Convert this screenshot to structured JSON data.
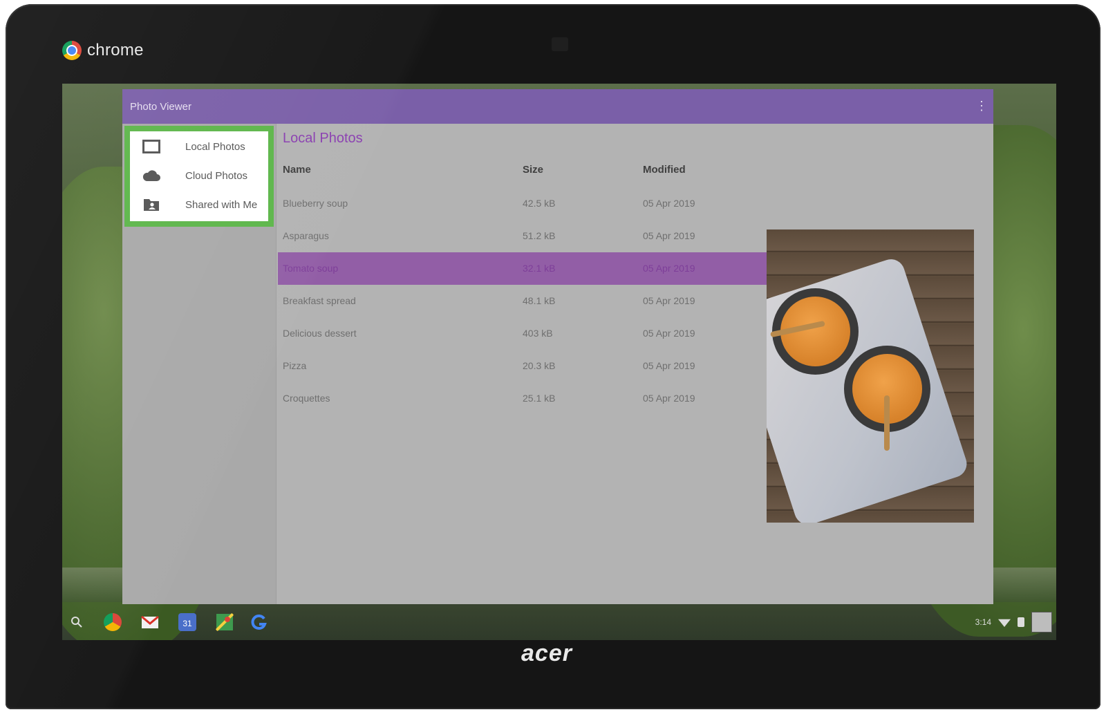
{
  "device": {
    "brand_label": "chrome",
    "logo_text": "acer"
  },
  "app": {
    "title": "Photo Viewer",
    "menu_icon": "more-vertical-icon"
  },
  "sidebar": {
    "items": [
      {
        "label": "Local Photos",
        "icon": "photo-frame-icon"
      },
      {
        "label": "Cloud Photos",
        "icon": "cloud-icon"
      },
      {
        "label": "Shared with Me",
        "icon": "shared-folder-icon"
      }
    ]
  },
  "main": {
    "section_title": "Local Photos",
    "columns": {
      "name": "Name",
      "size": "Size",
      "modified": "Modified"
    },
    "rows": [
      {
        "name": "Blueberry soup",
        "size": "42.5 kB",
        "modified": "05 Apr 2019"
      },
      {
        "name": "Asparagus",
        "size": "51.2 kB",
        "modified": "05 Apr 2019"
      },
      {
        "name": "Tomato soup",
        "size": "32.1 kB",
        "modified": "05 Apr 2019",
        "selected": true
      },
      {
        "name": "Breakfast spread",
        "size": "48.1 kB",
        "modified": "05 Apr 2019"
      },
      {
        "name": "Delicious dessert",
        "size": "403 kB",
        "modified": "05 Apr 2019"
      },
      {
        "name": "Pizza",
        "size": "20.3 kB",
        "modified": "05 Apr 2019"
      },
      {
        "name": "Croquettes",
        "size": "25.1 kB",
        "modified": "05 Apr 2019"
      }
    ],
    "preview_image": "tomato-soup-photo"
  },
  "shelf": {
    "time": "3:14",
    "apps": [
      "search-icon",
      "chrome-icon",
      "gmail-icon",
      "calendar-icon",
      "maps-icon",
      "google-icon"
    ],
    "calendar_day": "31"
  },
  "colors": {
    "titlebar": "#7a5fa8",
    "section_title": "#8a3fb0",
    "selected_row": "#925ea6",
    "highlight_border": "#5db64a"
  }
}
